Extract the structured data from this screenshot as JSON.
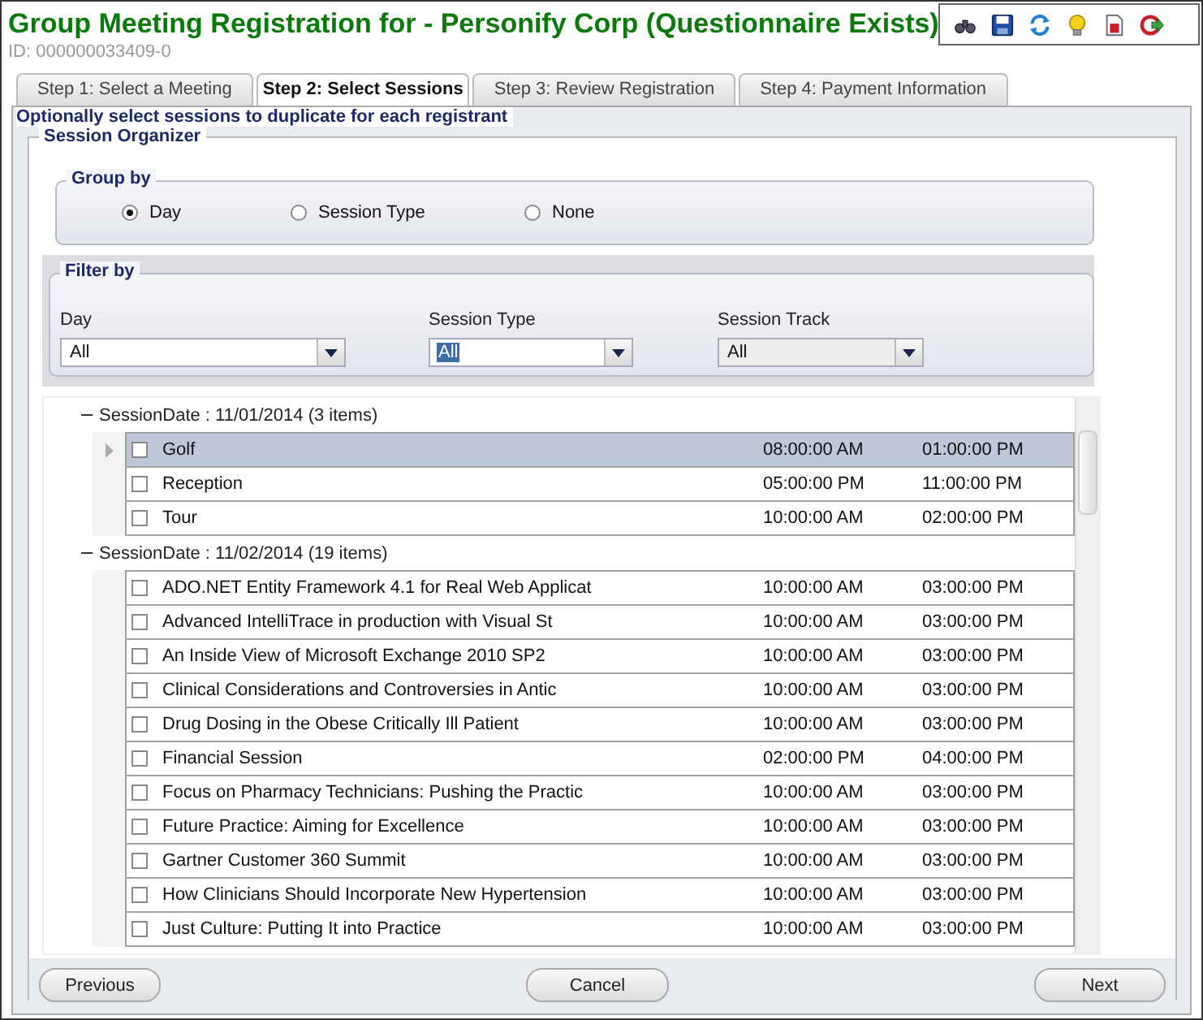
{
  "window": {
    "title": "Group Meeting Registration for - Personify Corp (Questionnaire Exists)",
    "id_label": "ID: 000000033409-0"
  },
  "tabs": [
    {
      "label": "Step 1: Select a Meeting",
      "selected": false
    },
    {
      "label": "Step 2: Select Sessions",
      "selected": true
    },
    {
      "label": "Step 3: Review Registration",
      "selected": false
    },
    {
      "label": "Step 4: Payment Information",
      "selected": false
    }
  ],
  "section_title": "Optionally select sessions to duplicate for each registrant",
  "organizer_title": "Session Organizer",
  "group_by": {
    "title": "Group by",
    "options": [
      {
        "label": "Day",
        "selected": true
      },
      {
        "label": "Session Type",
        "selected": false
      },
      {
        "label": "None",
        "selected": false
      }
    ]
  },
  "filter_by": {
    "title": "Filter by",
    "fields": [
      {
        "label": "Day",
        "value": "All",
        "highlighted": false,
        "disabled": false
      },
      {
        "label": "Session Type",
        "value": "All",
        "highlighted": true,
        "disabled": false
      },
      {
        "label": "Session Track",
        "value": "All",
        "highlighted": false,
        "disabled": true
      }
    ]
  },
  "groups": [
    {
      "header": "SessionDate : 11/01/2014 (3 items)",
      "expanded": true,
      "rows": [
        {
          "name": "Golf",
          "start": "08:00:00 AM",
          "end": "01:00:00 PM",
          "checked": false,
          "selected": true
        },
        {
          "name": "Reception",
          "start": "05:00:00 PM",
          "end": "11:00:00 PM",
          "checked": false,
          "selected": false
        },
        {
          "name": "Tour",
          "start": "10:00:00 AM",
          "end": "02:00:00 PM",
          "checked": false,
          "selected": false
        }
      ]
    },
    {
      "header": "SessionDate : 11/02/2014 (19 items)",
      "expanded": true,
      "rows": [
        {
          "name": "ADO.NET Entity Framework 4.1 for Real Web Applicat",
          "start": "10:00:00 AM",
          "end": "03:00:00 PM",
          "checked": false,
          "selected": false
        },
        {
          "name": "Advanced IntelliTrace in production with Visual St",
          "start": "10:00:00 AM",
          "end": "03:00:00 PM",
          "checked": false,
          "selected": false
        },
        {
          "name": "An Inside View of Microsoft Exchange 2010 SP2",
          "start": "10:00:00 AM",
          "end": "03:00:00 PM",
          "checked": false,
          "selected": false
        },
        {
          "name": "Clinical Considerations and Controversies in Antic",
          "start": "10:00:00 AM",
          "end": "03:00:00 PM",
          "checked": false,
          "selected": false
        },
        {
          "name": "Drug Dosing in the Obese Critically Ill Patient",
          "start": "10:00:00 AM",
          "end": "03:00:00 PM",
          "checked": false,
          "selected": false
        },
        {
          "name": "Financial Session",
          "start": "02:00:00 PM",
          "end": "04:00:00 PM",
          "checked": false,
          "selected": false
        },
        {
          "name": "Focus on Pharmacy Technicians: Pushing the Practic",
          "start": "10:00:00 AM",
          "end": "03:00:00 PM",
          "checked": false,
          "selected": false
        },
        {
          "name": "Future Practice: Aiming for Excellence",
          "start": "10:00:00 AM",
          "end": "03:00:00 PM",
          "checked": false,
          "selected": false
        },
        {
          "name": "Gartner Customer 360 Summit",
          "start": "10:00:00 AM",
          "end": "03:00:00 PM",
          "checked": false,
          "selected": false
        },
        {
          "name": "How Clinicians Should Incorporate New Hypertension",
          "start": "10:00:00 AM",
          "end": "03:00:00 PM",
          "checked": false,
          "selected": false
        },
        {
          "name": "Just Culture: Putting It into Practice",
          "start": "10:00:00 AM",
          "end": "03:00:00 PM",
          "checked": false,
          "selected": false
        }
      ]
    }
  ],
  "buttons": [
    {
      "label": "Previous"
    },
    {
      "label": "Cancel"
    },
    {
      "label": "Next"
    }
  ]
}
